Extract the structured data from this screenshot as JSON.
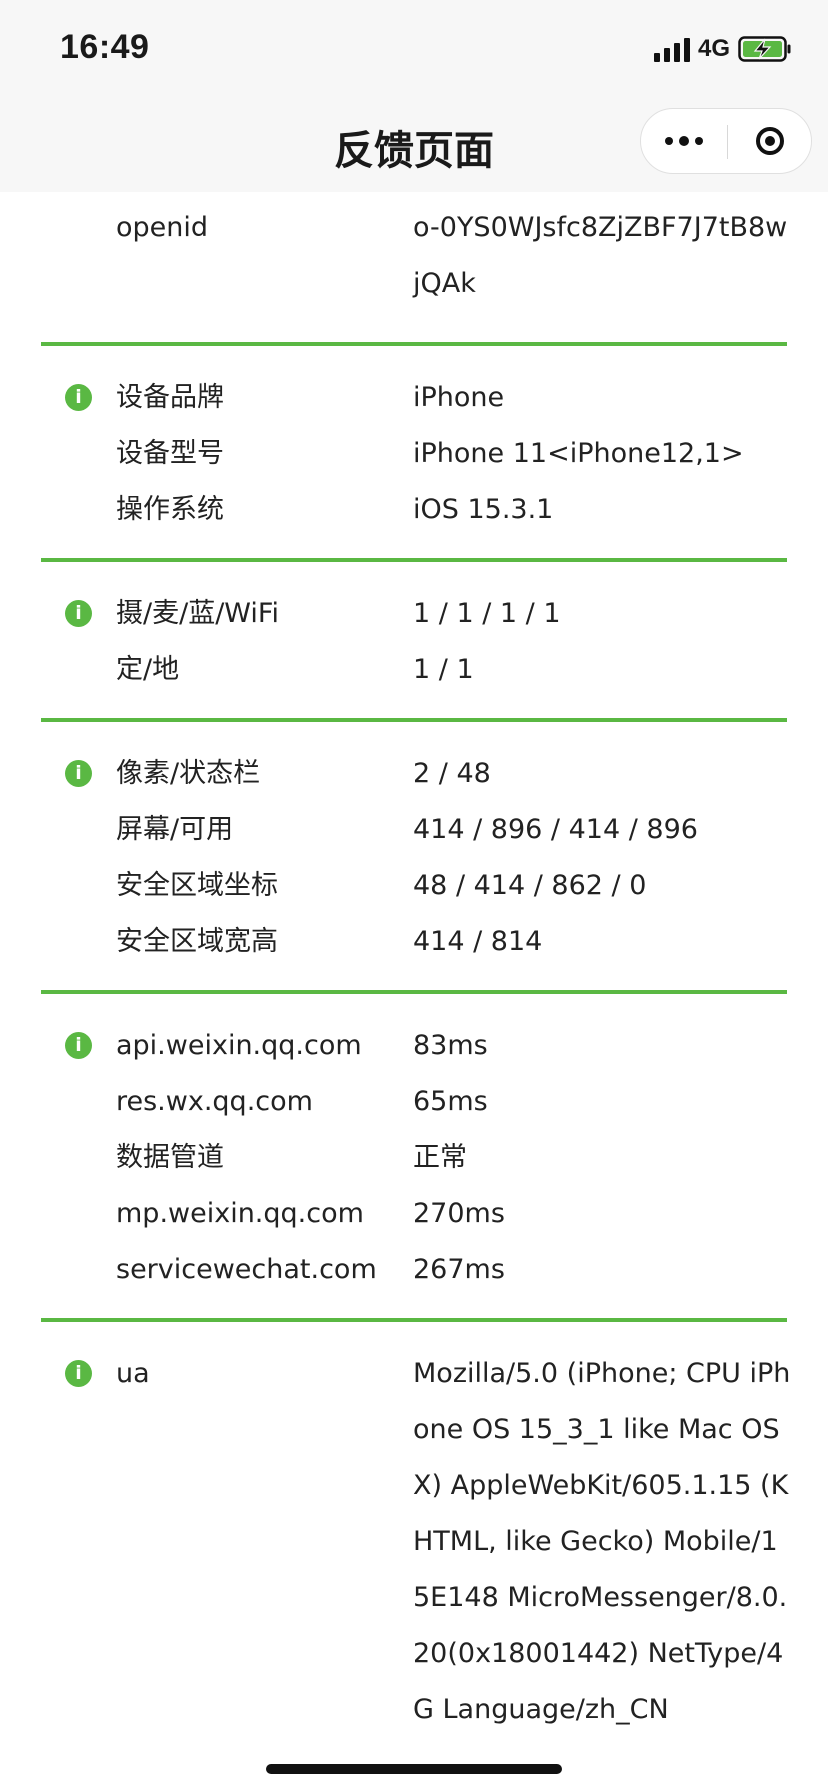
{
  "status_bar": {
    "time": "16:49",
    "network": "4G",
    "signal_icon": "signal-bars-icon",
    "battery_icon": "battery-charging-icon",
    "battery_color": "#5ab843"
  },
  "nav": {
    "title": "反馈页面",
    "more_icon": "more-dots-icon",
    "close_icon": "target-close-icon"
  },
  "accent_color": "#5ab843",
  "sections": {
    "account": {
      "rows": [
        {
          "label": "openid",
          "value": "o-0YS0WJsfc8ZjZBF7J7tB8wjQAk"
        }
      ]
    },
    "device": {
      "icon": "info-icon",
      "rows": [
        {
          "label": "设备品牌",
          "value": "iPhone"
        },
        {
          "label": "设备型号",
          "value": "iPhone 11<iPhone12,1>"
        },
        {
          "label": "操作系统",
          "value": "iOS 15.3.1"
        }
      ]
    },
    "permissions": {
      "icon": "info-icon",
      "rows": [
        {
          "label": "摄/麦/蓝/WiFi",
          "value": "1 / 1 / 1 / 1"
        },
        {
          "label": "定/地",
          "value": "1 / 1"
        }
      ]
    },
    "screen": {
      "icon": "info-icon",
      "rows": [
        {
          "label": "像素/状态栏",
          "value": "2 / 48"
        },
        {
          "label": "屏幕/可用",
          "value": "414 / 896 / 414 / 896"
        },
        {
          "label": "安全区域坐标",
          "value": "48 / 414 / 862 / 0"
        },
        {
          "label": "安全区域宽高",
          "value": "414 / 814"
        }
      ]
    },
    "network": {
      "icon": "info-icon",
      "rows": [
        {
          "label": "api.weixin.qq.com",
          "value": "83ms"
        },
        {
          "label": "res.wx.qq.com",
          "value": "65ms"
        },
        {
          "label": "数据管道",
          "value": "正常"
        },
        {
          "label": "mp.weixin.qq.com",
          "value": "270ms"
        },
        {
          "label": "servicewechat.com",
          "value": "267ms"
        }
      ]
    },
    "ua": {
      "icon": "info-icon",
      "rows": [
        {
          "label": "ua",
          "value": "Mozilla/5.0 (iPhone; CPU iPhone OS 15_3_1 like Mac OS X) AppleWebKit/605.1.15 (KHTML, like Gecko) Mobile/15E148 MicroMessenger/8.0.20(0x18001442) NetType/4G Language/zh_CN"
        }
      ]
    }
  }
}
